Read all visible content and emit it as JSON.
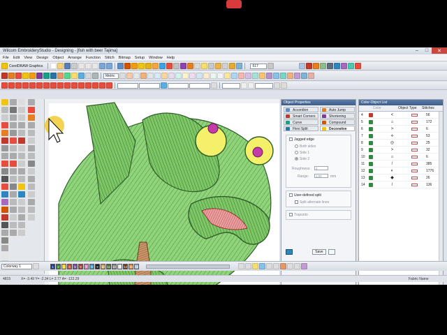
{
  "window": {
    "title": "Wilcom EmbroideryStudio - Designing - [fish with beer    Tajima]",
    "controls": [
      "–",
      "□",
      "✕"
    ]
  },
  "menu": [
    "File",
    "Edit",
    "View",
    "Design",
    "Object",
    "Arrange",
    "Function",
    "Stitch",
    "Bitmap",
    "Setup",
    "Window",
    "Help"
  ],
  "toolbar": {
    "graphics_label": "CorelDRAW Graphics",
    "unit_value": "Metric",
    "zoom_value": "517"
  },
  "object_properties": {
    "title": "Object Properties",
    "tabs": [
      "Accordion",
      "Auto Jump",
      "Smart Corners",
      "Shortening",
      "Curve",
      "Compound Chenille",
      "Flexi Split",
      "Decorative"
    ],
    "jagged_edge": "Jagged edge",
    "both_sides": "Both sides",
    "side1": "Side 1",
    "side2": "Side 2",
    "roughness_label": "Roughness:",
    "roughness_value": "2",
    "range_label": "Range:",
    "range_value": "3.00",
    "range_unit": "mm",
    "user_split": "User-defined split",
    "split_alternate": "Split alternate lines",
    "trapunto": "Trapunto",
    "save_button": "Save"
  },
  "color_object_list": {
    "title": "Color-Object List",
    "columns": [
      "Color",
      "Object Type",
      "Stitches"
    ],
    "rows": [
      {
        "num": "4",
        "color": "#c0392b",
        "stitches": "56"
      },
      {
        "num": "5",
        "color": "#2e8b3d",
        "stitches": "172"
      },
      {
        "num": "6",
        "color": "#2e8b3d",
        "stitches": "6"
      },
      {
        "num": "7",
        "color": "#2e8b3d",
        "stitches": "53"
      },
      {
        "num": "8",
        "color": "#2e8b3d",
        "stitches": "25"
      },
      {
        "num": "9",
        "color": "#2e8b3d",
        "stitches": "32"
      },
      {
        "num": "10",
        "color": "#2e8b3d",
        "stitches": "6"
      },
      {
        "num": "11",
        "color": "#2e8b3d",
        "stitches": "385"
      },
      {
        "num": "12",
        "color": "#2e8b3d",
        "stitches": "1776"
      },
      {
        "num": "13",
        "color": "#2e8b3d",
        "stitches": "26"
      },
      {
        "num": "14",
        "color": "#2e8b3d",
        "stitches": "136"
      }
    ],
    "row_icons": [
      "<",
      "⌂",
      ">",
      "⟡",
      "◎",
      ">",
      "⌂",
      "/",
      "◐",
      "◆",
      "/"
    ]
  },
  "bottom": {
    "colorway": "Colorway 1",
    "palette": [
      "#1f3f9e",
      "#2e8b3d",
      "#ffd400",
      "#e0472b",
      "#7a4ea3",
      "#c0392b",
      "#d98ec7",
      "#30a3d8",
      "#1a1a1a",
      "#d9a44a",
      "#3e7b2f",
      "#888888",
      "#e6e6e6",
      "#6a3a1e",
      "#f08c2e",
      "#9ec3e6"
    ],
    "palette_labels": [
      "1",
      "2",
      "3",
      "4",
      "5",
      "6",
      "7",
      "8",
      "9",
      "10",
      "11",
      "12",
      "13",
      "14",
      "15",
      "16"
    ]
  },
  "status": {
    "left": "4815",
    "coords": "X= -3.49 Y= -2.34 L= 2.77 A= -122.29",
    "right": "Fabric Name"
  },
  "colors": {
    "fish_green": "#7fca6a",
    "stitch_dark": "#2f5e28",
    "eye_yellow": "#f5f06a",
    "eye_pink": "#c43aa8",
    "mouth_red": "#c8363a",
    "bottle_brown": "#a87048"
  }
}
